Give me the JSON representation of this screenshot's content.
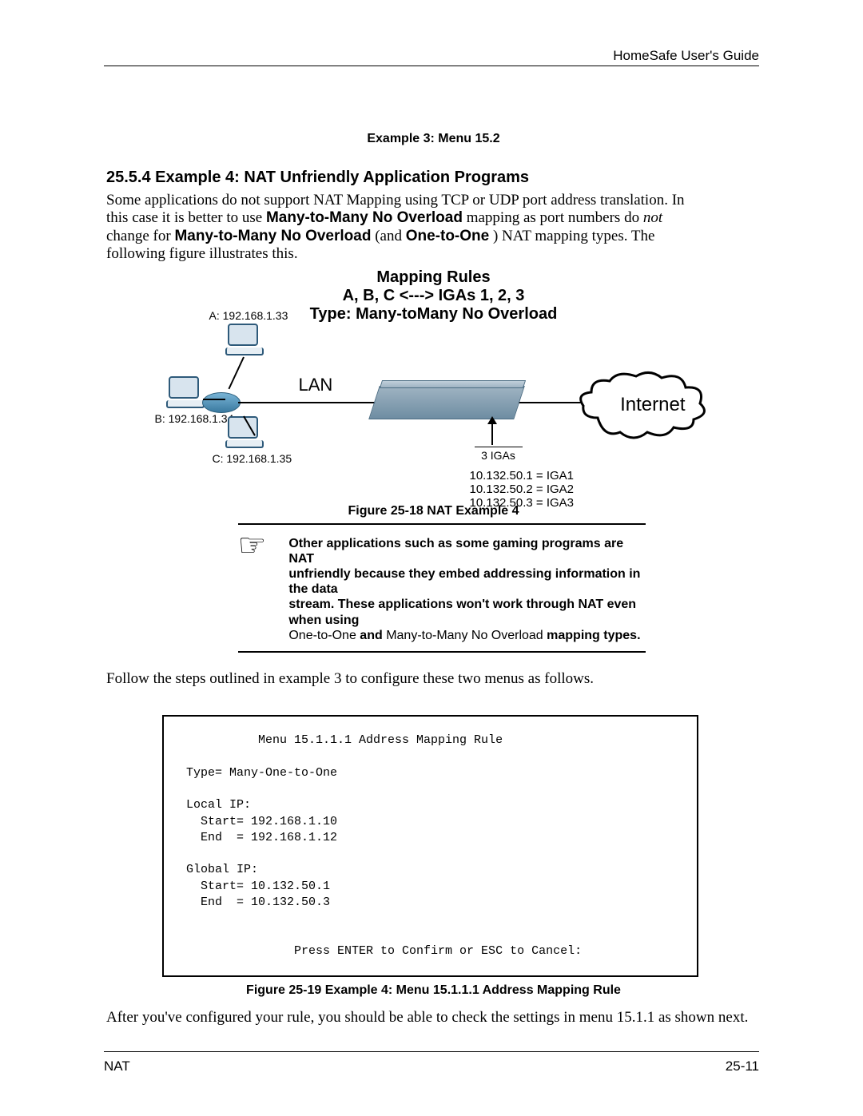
{
  "header": {
    "doc_title": "HomeSafe User's Guide"
  },
  "footer": {
    "left": "NAT",
    "right": "25-11"
  },
  "example3Caption": "Example 3: Menu 15.2",
  "section": {
    "number": "25.5.4",
    "title": "Example 4: NAT Unfriendly Application Programs"
  },
  "intro": {
    "line1": "Some applications do not support NAT Mapping using TCP or UDP port address translation. In",
    "line2a": "this case it is better to use ",
    "line2b_bold": "Many-to-Many No Overload",
    "line2c": " mapping as port numbers do ",
    "line2d_italic": "not",
    "line3a": "change for ",
    "line3b_bold": "Many-to-Many No Overload",
    "line3c": " (and ",
    "line3d_bold": "One-to-One",
    "line3e": ") NAT mapping types. The",
    "line4": "following figure illustrates this."
  },
  "diagram": {
    "title1": "Mapping Rules",
    "title2": "A, B, C <---> IGAs 1, 2, 3",
    "title3": "Type: Many-toMany No Overload",
    "lan": "LAN",
    "internet": "Internet",
    "hostA": "A: 192.168.1.33",
    "hostB": "B: 192.168.1.34",
    "hostC": "C: 192.168.1.35",
    "three_igas": "3 IGAs",
    "iga1": "10.132.50.1 = IGA1",
    "iga2": "10.132.50.2 = IGA2",
    "iga3": "10.132.50.3 = IGA3"
  },
  "fig18Caption": "Figure 25-18 NAT Example 4",
  "callout": {
    "l1": "Other applications such as some gaming programs are NAT",
    "l2": "unfriendly because they embed addressing information in the data",
    "l3": "stream. These applications won't work through NAT even when using",
    "l4a_plain": "One-to-One ",
    "l4b_bold": "and ",
    "l4c_plain": "Many-to-Many No Overload ",
    "l4d_bold": "mapping types."
  },
  "followText": "Follow the steps outlined in example 3 to configure these two menus as follows.",
  "terminal": {
    "title": "          Menu 15.1.1.1 Address Mapping Rule",
    "type": "Type= Many-One-to-One",
    "lip": "Local IP:",
    "lstart": "  Start= 192.168.1.10",
    "lend": "  End  = 192.168.1.12",
    "gip": "Global IP:",
    "gstart": "  Start= 10.132.50.1",
    "gend": "  End  = 10.132.50.3",
    "press": "               Press ENTER to Confirm or ESC to Cancel:"
  },
  "fig19Caption": "Figure 25-19 Example 4: Menu 15.1.1.1 Address Mapping Rule",
  "afterText": "After you've configured your rule, you should be able to check the settings in menu 15.1.1 as shown next."
}
